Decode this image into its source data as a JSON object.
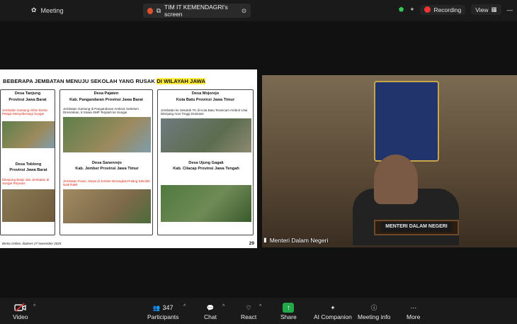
{
  "top": {
    "meeting_label": "Meeting",
    "share_title": "TIM IT KEMENDAGRI's screen",
    "recording": "Recording",
    "view": "View"
  },
  "slide": {
    "title_prefix": "BEBERAPA JEMBATAN MENUJU SEKOLAH YANG RUSAK ",
    "title_highlight": "DI WILAYAH JAWA",
    "col1_a": "Desa Tanjung",
    "col1_b": "Provinsi Jawa Barat",
    "col1_headline": "Jembatan Gantung Akhiri Derita Pelajar Menyeberangi Sungai",
    "col1_c": "Desa Toblong",
    "col1_d": "Provinsi Jawa Barat",
    "col1_headline2": "Dikepung Banjir dan Jembatan di Sungai Terputus",
    "col2_a": "Desa Pajaten",
    "col2_b": "Kab. Pangandaran Provinsi Jawa Barat",
    "col2_headline": "Jembatan Gantung di Pangandaran Ambruk Sebelum Diresmikan, 8 Siswa SMP Terjatuh ke Sungai",
    "col2_c": "Desa Sanenrejo",
    "col2_d": "Kab. Jember Provinsi Jawa Timur",
    "col2_headline2": "Jembatan Putus, Siswa di Jember Berangkat-Pulang Sekolah Naik Rakit",
    "col3_a": "Desa Mojorejo",
    "col3_b": "Kota Batu Provinsi Jawa Timur",
    "col3_headline": "Jembatan ke Sekolah TK di Kota Batu Terancam Ambrol Usai Diterjang Arus Tinggi Drainase",
    "col3_c": "Desa Ujung Gagak",
    "col3_d": "Kab. Cilacap Provinsi Jawa Tengah",
    "source": "Berita Online, diakses 27 November 2025",
    "page_number": "29"
  },
  "video": {
    "name": "Menteri Dalam Negeri",
    "plate": "MENTERI DALAM NEGERI"
  },
  "bottom": {
    "video": "Video",
    "participants": "Participants",
    "participants_count": "347",
    "chat": "Chat",
    "react": "React",
    "share": "Share",
    "ai": "AI Companion",
    "info": "Meeting info",
    "more": "More"
  }
}
